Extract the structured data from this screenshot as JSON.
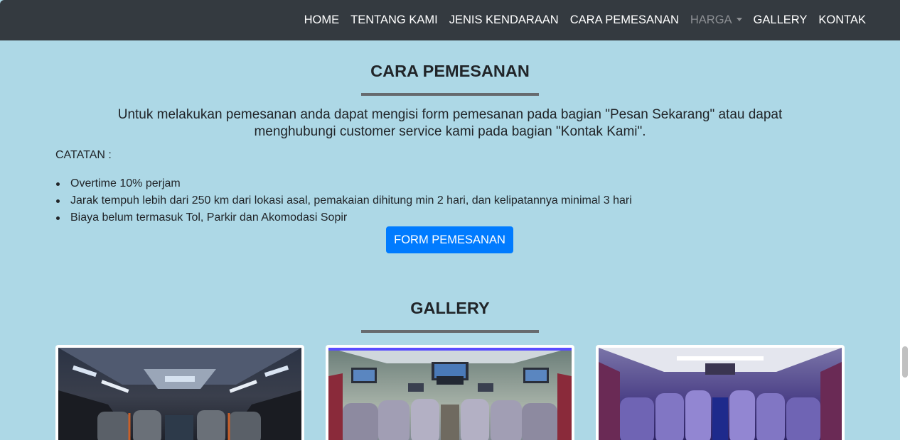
{
  "nav": {
    "items": [
      {
        "label": "HOME",
        "active": false
      },
      {
        "label": "TENTANG KAMI",
        "active": false
      },
      {
        "label": "JENIS KENDARAAN",
        "active": false
      },
      {
        "label": "CARA PEMESANAN",
        "active": false
      },
      {
        "label": "HARGA",
        "active": true,
        "dropdown": true
      },
      {
        "label": "GALLERY",
        "active": false
      },
      {
        "label": "KONTAK",
        "active": false
      }
    ]
  },
  "cara": {
    "title": "CARA PEMESANAN",
    "intro": "Untuk melakukan pemesanan anda dapat mengisi form pemesanan pada bagian \"Pesan Sekarang\" atau dapat menghubungi customer service kami pada bagian \"Kontak Kami\".",
    "catatan_label": "CATATAN :",
    "notes": [
      "Overtime 10% perjam",
      "Jarak tempuh lebih dari 250 km dari lokasi asal, pemakaian dihitung min 2 hari, dan kelipatannya minimal 3 hari",
      "Biaya belum termasuk Tol, Parkir dan Akomodasi Sopir"
    ],
    "button_label": "FORM PEMESANAN"
  },
  "gallery": {
    "title": "GALLERY",
    "images": [
      "bus-interior-photo-1",
      "bus-interior-photo-2",
      "bus-interior-photo-3"
    ]
  },
  "colors": {
    "background": "#add8e6",
    "navbar": "#343a40",
    "primary": "#007bff"
  }
}
